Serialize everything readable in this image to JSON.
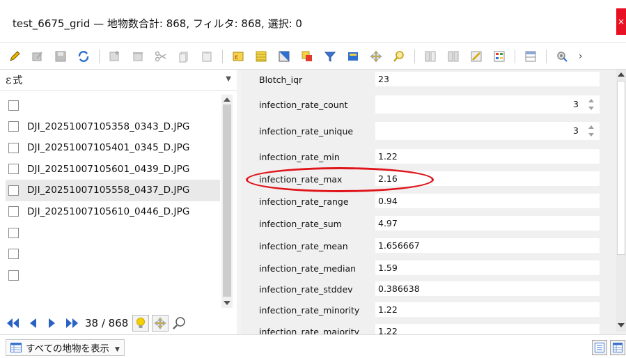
{
  "window": {
    "title": "test_6675_grid — 地物数合計: 868, フィルタ: 868, 選択: 0",
    "close_label": "×"
  },
  "toolbar": {
    "more_label": "›",
    "icons": [
      "toggle-edit-icon",
      "multi-edit-icon",
      "save-edits-icon",
      "reload-icon",
      "add-feature-icon",
      "delete-feature-icon",
      "cut-icon",
      "copy-icon",
      "paste-icon",
      "expression-select-icon",
      "select-all-icon",
      "invert-selection-icon",
      "deselect-icon",
      "filter-selected-icon",
      "move-selection-top-icon",
      "pan-to-selected-icon",
      "zoom-to-selected-icon",
      "new-field-icon",
      "delete-field-icon",
      "field-calculator-icon",
      "conditional-formatting-icon",
      "dock-icon",
      "actions-icon"
    ]
  },
  "left": {
    "expression_icon": "ε",
    "expression_label": "式",
    "files": [
      "",
      "DJI_20251007105358_0343_D.JPG",
      "DJI_20251007105401_0345_D.JPG",
      "DJI_20251007105601_0439_D.JPG",
      "DJI_20251007105558_0437_D.JPG",
      "DJI_20251007105610_0446_D.JPG",
      "",
      "",
      ""
    ],
    "selected_index": 4,
    "nav_count": "38 / 868"
  },
  "form": {
    "fields": [
      {
        "label": "Blotch_iqr",
        "value": "23",
        "numeric": false
      },
      {
        "label": "infection_rate_count",
        "value": "3",
        "numeric": true
      },
      {
        "label": "infection_rate_unique",
        "value": "3",
        "numeric": true
      },
      {
        "label": "infection_rate_min",
        "value": "1.22",
        "numeric": false
      },
      {
        "label": "infection_rate_max",
        "value": "2.16",
        "numeric": false
      },
      {
        "label": "infection_rate_range",
        "value": "0.94",
        "numeric": false
      },
      {
        "label": "infection_rate_sum",
        "value": "4.97",
        "numeric": false
      },
      {
        "label": "infection_rate_mean",
        "value": "1.656667",
        "numeric": false
      },
      {
        "label": "infection_rate_median",
        "value": "1.59",
        "numeric": false
      },
      {
        "label": "infection_rate_stddev",
        "value": "0.386638",
        "numeric": false
      },
      {
        "label": "infection_rate_minority",
        "value": "1.22",
        "numeric": false
      },
      {
        "label": "infection_rate_majority",
        "value": "1.22",
        "numeric": false
      }
    ],
    "highlighted_field": "infection_rate_max",
    "highlight_color": "#e0151b"
  },
  "bottom": {
    "show_all_label": "すべての地物を表示"
  },
  "colors": {
    "close_button": "#e81123",
    "form_background": "#f0f0f0",
    "selected_row": "#e9e9e9"
  }
}
